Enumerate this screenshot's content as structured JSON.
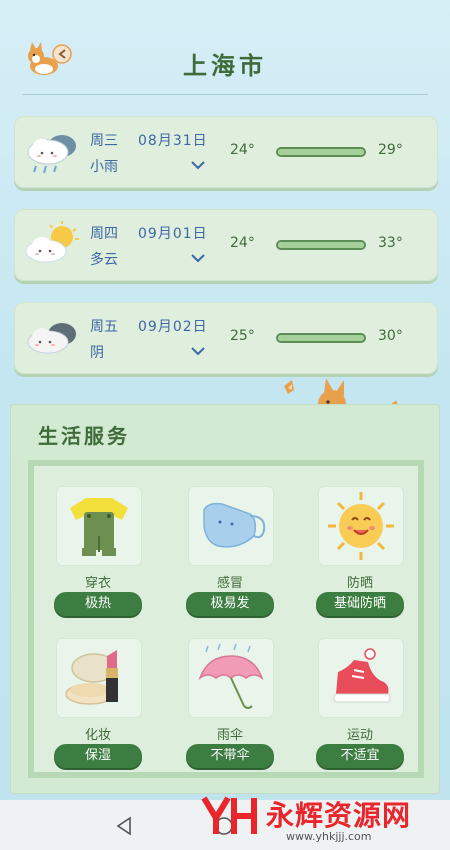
{
  "header": {
    "title": "上海市",
    "back_icon": "corgi-back-icon"
  },
  "forecast": [
    {
      "weekday": "周三",
      "date": "08月31日",
      "condition": "小雨",
      "icon": "rain-cloud-icon",
      "temp_min": "24°",
      "temp_max": "29°",
      "range_fill": 1.0
    },
    {
      "weekday": "周四",
      "date": "09月01日",
      "condition": "多云",
      "icon": "partly-cloudy-icon",
      "temp_min": "24°",
      "temp_max": "33°",
      "range_fill": 1.0
    },
    {
      "weekday": "周五",
      "date": "09月02日",
      "condition": "阴",
      "icon": "overcast-cloud-icon",
      "temp_min": "25°",
      "temp_max": "30°",
      "range_fill": 1.0
    }
  ],
  "life_services": {
    "title": "生活服务",
    "items": [
      {
        "label": "穿衣",
        "value": "极热",
        "icon": "clothing-icon"
      },
      {
        "label": "感冒",
        "value": "极易发",
        "icon": "mask-icon"
      },
      {
        "label": "防晒",
        "value": "基础防晒",
        "icon": "sun-icon"
      },
      {
        "label": "化妆",
        "value": "保湿",
        "icon": "makeup-icon"
      },
      {
        "label": "雨伞",
        "value": "不带伞",
        "icon": "umbrella-icon"
      },
      {
        "label": "运动",
        "value": "不适宜",
        "icon": "sneaker-icon"
      }
    ]
  },
  "watermark": {
    "name": "永辉资源网",
    "url": "www.yhkjjj.com"
  },
  "colors": {
    "accent_green": "#3c7d41",
    "text_blue": "#3c68a6",
    "card_bg": "#dfeedd",
    "watermark_red": "#e8262b"
  }
}
